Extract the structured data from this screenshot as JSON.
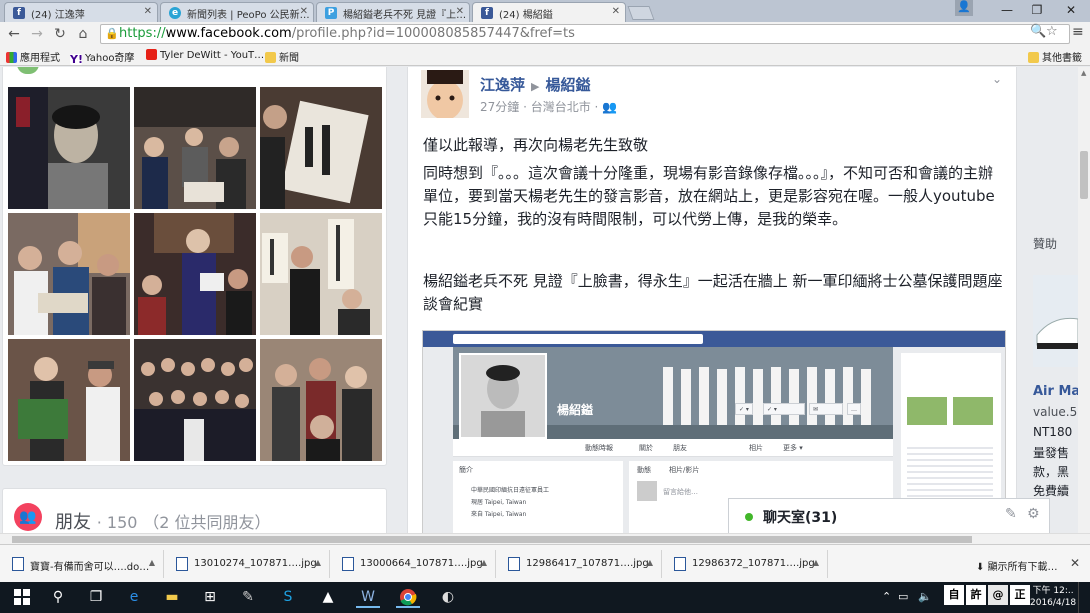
{
  "browser": {
    "tabs": [
      {
        "icon": "facebook-icon",
        "title": "(24) 江逸萍"
      },
      {
        "icon": "news-icon",
        "title": "新聞列表 | PeoPo 公民新…"
      },
      {
        "icon": "peopo-icon",
        "title": "楊紹鎰老兵不死 見證『上…"
      },
      {
        "icon": "facebook-icon",
        "title": "(24) 楊紹鎰"
      }
    ],
    "url": {
      "scheme": "https://",
      "host": "www.facebook.com",
      "rest": "/profile.php?id=100008085857447&fref=ts"
    },
    "bookmarks": [
      "應用程式",
      "Yahoo奇摩",
      "Tyler DeWitt - YouT…",
      "新聞"
    ],
    "other_bookmarks": "其他書籤"
  },
  "left_column": {
    "friends_title": "朋友",
    "friends_count": "· 150",
    "friends_mutual": "（2 位共同朋友）"
  },
  "post": {
    "author": "江逸萍",
    "target": "楊紹鎰",
    "meta": "27分鐘 · 台灣台北市 ·",
    "p1": "僅以此報導，再次向楊老先生致敬",
    "p2": "同時想到『。。。這次會議十分隆重，現場有影音錄像存檔。。。』，不知可否和會議的主辦單位，要到當天楊老先生的發言影音，放在網站上，更是影容宛在喔。一般人youtube只能15分鐘，我的沒有時間限制，可以代勞上傳，是我的榮幸。",
    "p3": "楊紹鎰老兵不死 見證『上臉書，得永生』一起活在牆上 新一軍印緬將士公墓保護問題座談會紀實",
    "embed": {
      "profile_name": "楊紹鎰",
      "nav": [
        "動態時報",
        "關於",
        "朋友",
        "相片",
        "更多 ▾"
      ],
      "intro": "簡介",
      "intro_lines": [
        "中華民國印緬抗日遠征軍員工",
        "現居 Taipei, Taiwan",
        "來自 Taipei, Taiwan"
      ],
      "composer_tabs": [
        "動態",
        "相片/影片"
      ],
      "composer_placeholder": "留言給他…"
    }
  },
  "right_rail": {
    "sponsored": "贊助",
    "ad_title": "Air Ma",
    "ad_site": "value.5",
    "ad_lines": [
      "NT180",
      "量發售",
      "款，黑",
      "免費續"
    ]
  },
  "chat": {
    "label": "聊天室(31)"
  },
  "downloads": {
    "items": [
      "寶寶-有備而舍可以….do…",
      "13010274_107871….jpg",
      "13000664_107871….jpg",
      "12986417_107871….jpg",
      "12986372_107871….jpg"
    ],
    "show_all": "顯示所有下載…"
  },
  "taskbar": {
    "ime": [
      "自",
      "許",
      "@",
      "正",
      "⬜"
    ],
    "time": "下午 12:..",
    "date": "2016/4/18"
  },
  "colors": {
    "facebook_blue": "#3b5998",
    "link_blue": "#365899",
    "chat_green": "#42b72a",
    "friends_red": "#f3425f"
  }
}
